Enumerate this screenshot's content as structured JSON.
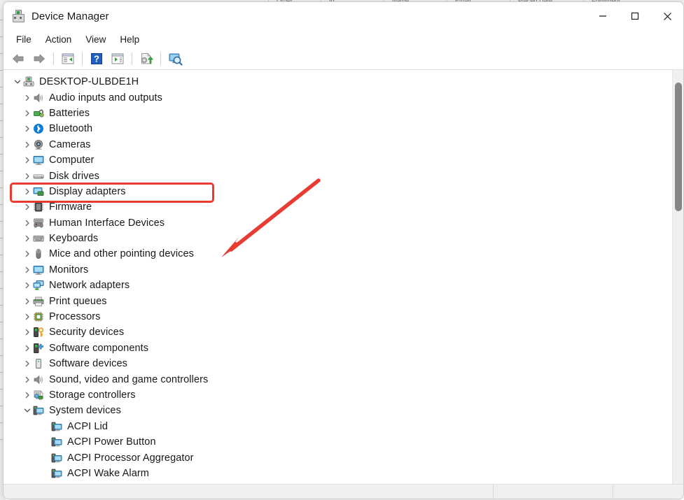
{
  "window": {
    "title": "Device Manager",
    "app_icon": "device-manager-icon",
    "controls": {
      "minimize": "Minimize",
      "maximize": "Maximize",
      "close": "Close"
    }
  },
  "menubar": {
    "items": [
      {
        "label": "File"
      },
      {
        "label": "Action"
      },
      {
        "label": "View"
      },
      {
        "label": "Help"
      }
    ]
  },
  "toolbar": {
    "buttons": [
      {
        "name": "back-arrow-icon",
        "tooltip": "Back"
      },
      {
        "name": "forward-arrow-icon",
        "tooltip": "Forward"
      },
      {
        "name": "show-hide-console-tree-icon",
        "tooltip": "Show/Hide Console Tree"
      },
      {
        "name": "help-icon",
        "tooltip": "Help"
      },
      {
        "name": "properties-icon",
        "tooltip": "Properties"
      },
      {
        "name": "update-driver-icon",
        "tooltip": "Update driver"
      },
      {
        "name": "scan-for-hardware-changes-icon",
        "tooltip": "Scan for hardware changes"
      }
    ]
  },
  "tree": {
    "root": {
      "label": "DESKTOP-ULBDE1H",
      "icon": "computer-root-icon",
      "expanded": true,
      "level": 0
    },
    "items": [
      {
        "label": "Audio inputs and outputs",
        "icon": "speaker-icon",
        "expanded": false,
        "level": 1
      },
      {
        "label": "Batteries",
        "icon": "battery-icon",
        "expanded": false,
        "level": 1
      },
      {
        "label": "Bluetooth",
        "icon": "bluetooth-icon",
        "expanded": false,
        "level": 1
      },
      {
        "label": "Cameras",
        "icon": "camera-icon",
        "expanded": false,
        "level": 1
      },
      {
        "label": "Computer",
        "icon": "monitor-icon",
        "expanded": false,
        "level": 1
      },
      {
        "label": "Disk drives",
        "icon": "disk-drive-icon",
        "expanded": false,
        "level": 1
      },
      {
        "label": "Display adapters",
        "icon": "display-adapter-icon",
        "expanded": false,
        "level": 1,
        "highlighted": true
      },
      {
        "label": "Firmware",
        "icon": "firmware-chip-icon",
        "expanded": false,
        "level": 1
      },
      {
        "label": "Human Interface Devices",
        "icon": "hid-gamepad-icon",
        "expanded": false,
        "level": 1
      },
      {
        "label": "Keyboards",
        "icon": "keyboard-icon",
        "expanded": false,
        "level": 1
      },
      {
        "label": "Mice and other pointing devices",
        "icon": "mouse-icon",
        "expanded": false,
        "level": 1
      },
      {
        "label": "Monitors",
        "icon": "monitor-icon",
        "expanded": false,
        "level": 1
      },
      {
        "label": "Network adapters",
        "icon": "network-adapter-icon",
        "expanded": false,
        "level": 1
      },
      {
        "label": "Print queues",
        "icon": "printer-icon",
        "expanded": false,
        "level": 1
      },
      {
        "label": "Processors",
        "icon": "processor-icon",
        "expanded": false,
        "level": 1
      },
      {
        "label": "Security devices",
        "icon": "security-key-icon",
        "expanded": false,
        "level": 1
      },
      {
        "label": "Software components",
        "icon": "software-component-icon",
        "expanded": false,
        "level": 1
      },
      {
        "label": "Software devices",
        "icon": "software-device-icon",
        "expanded": false,
        "level": 1
      },
      {
        "label": "Sound, video and game controllers",
        "icon": "speaker-icon",
        "expanded": false,
        "level": 1
      },
      {
        "label": "Storage controllers",
        "icon": "storage-controller-icon",
        "expanded": false,
        "level": 1
      },
      {
        "label": "System devices",
        "icon": "system-device-icon",
        "expanded": true,
        "level": 1
      },
      {
        "label": "ACPI Lid",
        "icon": "system-device-icon",
        "level": 2
      },
      {
        "label": "ACPI Power Button",
        "icon": "system-device-icon",
        "level": 2
      },
      {
        "label": "ACPI Processor Aggregator",
        "icon": "system-device-icon",
        "level": 2
      },
      {
        "label": "ACPI Wake Alarm",
        "icon": "system-device-icon",
        "level": 2
      }
    ]
  },
  "annotations": {
    "highlight_color": "#e83b33",
    "highlight_target": "Display adapters",
    "arrow_color": "#e83b33",
    "arrow_points_to": "Display adapters"
  },
  "scrollbar": {
    "orientation": "vertical",
    "thumb_position_percent": 3,
    "thumb_size_percent": 31
  },
  "statusbar": {
    "main_text": "",
    "segment_1": "",
    "segment_2": ""
  },
  "background_strip": {
    "cells": [
      "Order",
      "Id",
      "Name",
      "Email",
      "Placed Date",
      "Fulfillment"
    ]
  }
}
